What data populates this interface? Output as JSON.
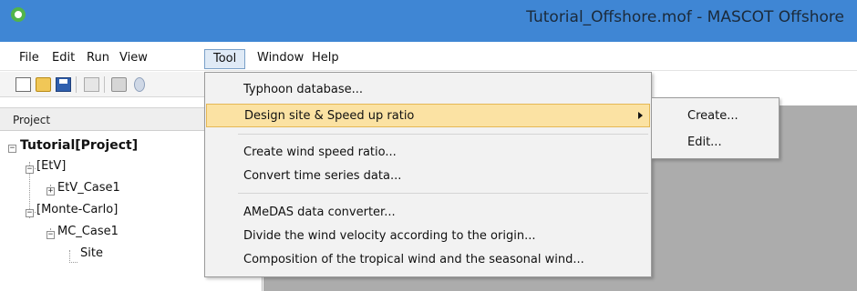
{
  "window": {
    "title": "Tutorial_Offshore.mof - MASCOT Offshore",
    "accent_color": "#3f86d4"
  },
  "menubar": {
    "items": [
      "File",
      "Edit",
      "Run",
      "View",
      "Tool",
      "Window",
      "Help"
    ],
    "open_menu": "Tool"
  },
  "toolbar": {
    "icons": [
      "new-file-icon",
      "open-folder-icon",
      "save-icon",
      "copy-icon",
      "print-icon"
    ]
  },
  "project_panel": {
    "header": "Project",
    "tree": {
      "root": "Tutorial[Project]",
      "etv": "[EtV]",
      "etv_case": "EtV_Case1",
      "monte_carlo": "[Monte-Carlo]",
      "mc_case": "MC_Case1",
      "site": "Site"
    }
  },
  "tool_menu": {
    "items": [
      "Typhoon database...",
      "Design site & Speed up ratio",
      "Create wind speed ratio...",
      "Convert time series data...",
      "AMeDAS data converter...",
      "Divide the wind velocity according to the origin...",
      "Composition of the tropical wind and the seasonal wind..."
    ],
    "highlighted": "Design site & Speed up ratio",
    "highlight_color": "#fbe2a3"
  },
  "submenu": {
    "items": [
      "Create...",
      "Edit..."
    ]
  }
}
